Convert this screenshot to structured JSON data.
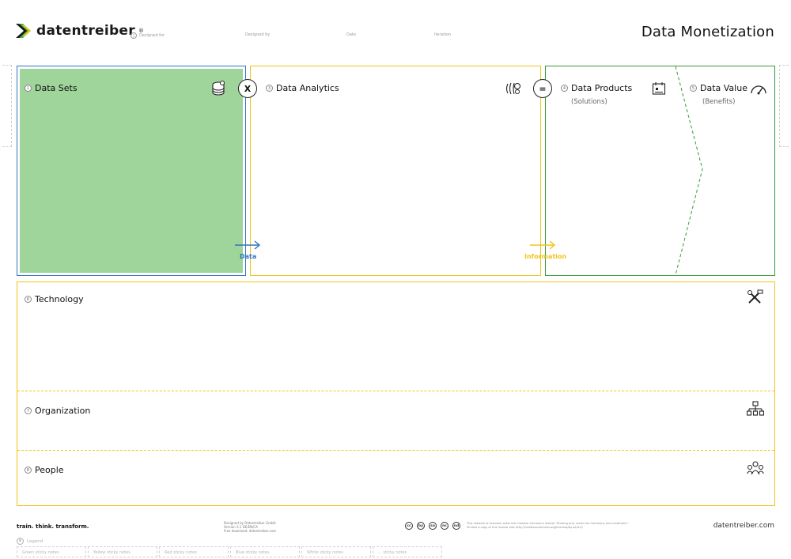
{
  "header": {
    "brand": "datentreiber",
    "brand_mark": "®",
    "title": "Data Monetization",
    "meta_fields": [
      {
        "number": "1",
        "label": "Designed for"
      },
      {
        "label": "Designed by"
      },
      {
        "label": "Date"
      },
      {
        "label": "Iteration"
      }
    ]
  },
  "canvas": {
    "data_sets": {
      "number": "1",
      "label": "Data Sets",
      "icon": "database-coins-icon"
    },
    "data_analytics": {
      "number": "3",
      "label": "Data Analytics",
      "icon": "brain-gears-icon"
    },
    "data_products": {
      "number": "4",
      "label": "Data Products",
      "sublabel": "(Solutions)",
      "icon": "calendar-board-icon"
    },
    "data_value": {
      "number": "5",
      "label": "Data Value",
      "sublabel": "(Benefits)",
      "icon": "speedometer-icon"
    },
    "operator_multiply": "X",
    "operator_equals": "=",
    "flow_data": "Data",
    "flow_information": "Information",
    "technology": {
      "number": "6",
      "label": "Technology",
      "icon": "tools-icon"
    },
    "organization": {
      "number": "7",
      "label": "Organization",
      "icon": "org-chart-icon"
    },
    "people": {
      "number": "8",
      "label": "People",
      "icon": "people-icon"
    }
  },
  "footer": {
    "slogan": "train. think. transform.",
    "credits_line1": "Designed by Datentreiber GmbH",
    "credits_line2": "Version 3.1 DE/EN/CA",
    "credits_line3": "Free download: datentreiber.com",
    "license_line1": "This material is licensed under the Creative Commons license \"Sharing only under the Commons and conditions\".",
    "license_line2": "To view a copy of this license visit http://creativecommons.org/licenses/by-sa/4.0/",
    "cc_icons": [
      "cc",
      "by",
      "sa",
      "nc",
      "nd"
    ],
    "website": "datentreiber.com",
    "legend": {
      "number": "9",
      "label": "Legend"
    },
    "sticky_notes": [
      "Green sticky notes",
      "Yellow sticky notes",
      "Red sticky notes",
      "Blue sticky notes",
      "White sticky notes",
      "... sticky notes"
    ]
  },
  "colors": {
    "green_fill": "#9fd49a",
    "blue": "#2f74c0",
    "yellow": "#f0c419",
    "green": "#3a9a3a",
    "dashed_yellow": "#f0c419"
  }
}
